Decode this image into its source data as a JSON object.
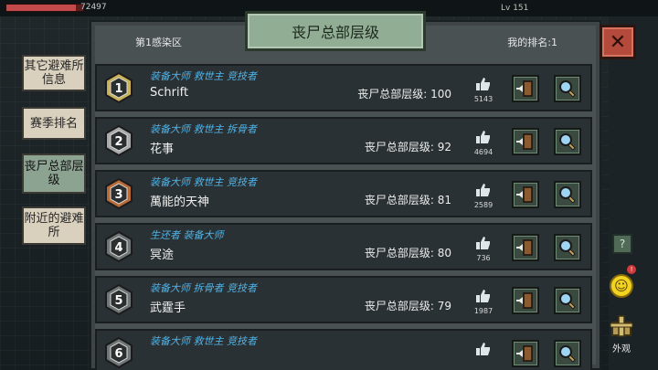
{
  "hud": {
    "hp_text": "72497",
    "hp_fraction": 0.9,
    "level_text": "Lv 151"
  },
  "header": {
    "region": "第1感染区",
    "title": "丧尸总部层级",
    "my_rank": "我的排名:1",
    "close_icon": "close-x-icon"
  },
  "tabs": [
    {
      "label": "其它避难所信息",
      "active": false
    },
    {
      "label": "赛季排名",
      "active": false
    },
    {
      "label": "丧尸总部层级",
      "active": true
    },
    {
      "label": "附近的避难所",
      "active": false
    }
  ],
  "rows": [
    {
      "rank": "1",
      "titles": "装备大师  救世主  竞技者",
      "name": "Schrift",
      "level": "丧尸总部层级: 100",
      "likes": "5143",
      "badge_color": "#c9b25a"
    },
    {
      "rank": "2",
      "titles": "装备大师  救世主  拆骨者",
      "name": "花事",
      "level": "丧尸总部层级: 92",
      "likes": "4694",
      "badge_color": "#a9aaab"
    },
    {
      "rank": "3",
      "titles": "装备大师  救世主  竞技者",
      "name": "萬能的天神",
      "level": "丧尸总部层级: 81",
      "likes": "2589",
      "badge_color": "#b66b39"
    },
    {
      "rank": "4",
      "titles": "生还者  装备大师",
      "name": "冥途",
      "level": "丧尸总部层级: 80",
      "likes": "736",
      "badge_color": "#6f7677"
    },
    {
      "rank": "5",
      "titles": "装备大师  拆骨者  竞技者",
      "name": "武霆手",
      "level": "丧尸总部层级: 79",
      "likes": "1987",
      "badge_color": "#6f7677"
    },
    {
      "rank": "6",
      "titles": "装备大师  救世主  竞技者",
      "name": "",
      "level": "",
      "likes": "",
      "badge_color": "#6f7677"
    }
  ],
  "side": {
    "help_label": "?",
    "look_label": "外观"
  },
  "colors": {
    "title_bg": "#91ad93",
    "tab_active": "#8da392",
    "tab_inactive": "#d9d0bd",
    "title_text": "#4fb3e8",
    "close_bg": "#b44a3b"
  }
}
